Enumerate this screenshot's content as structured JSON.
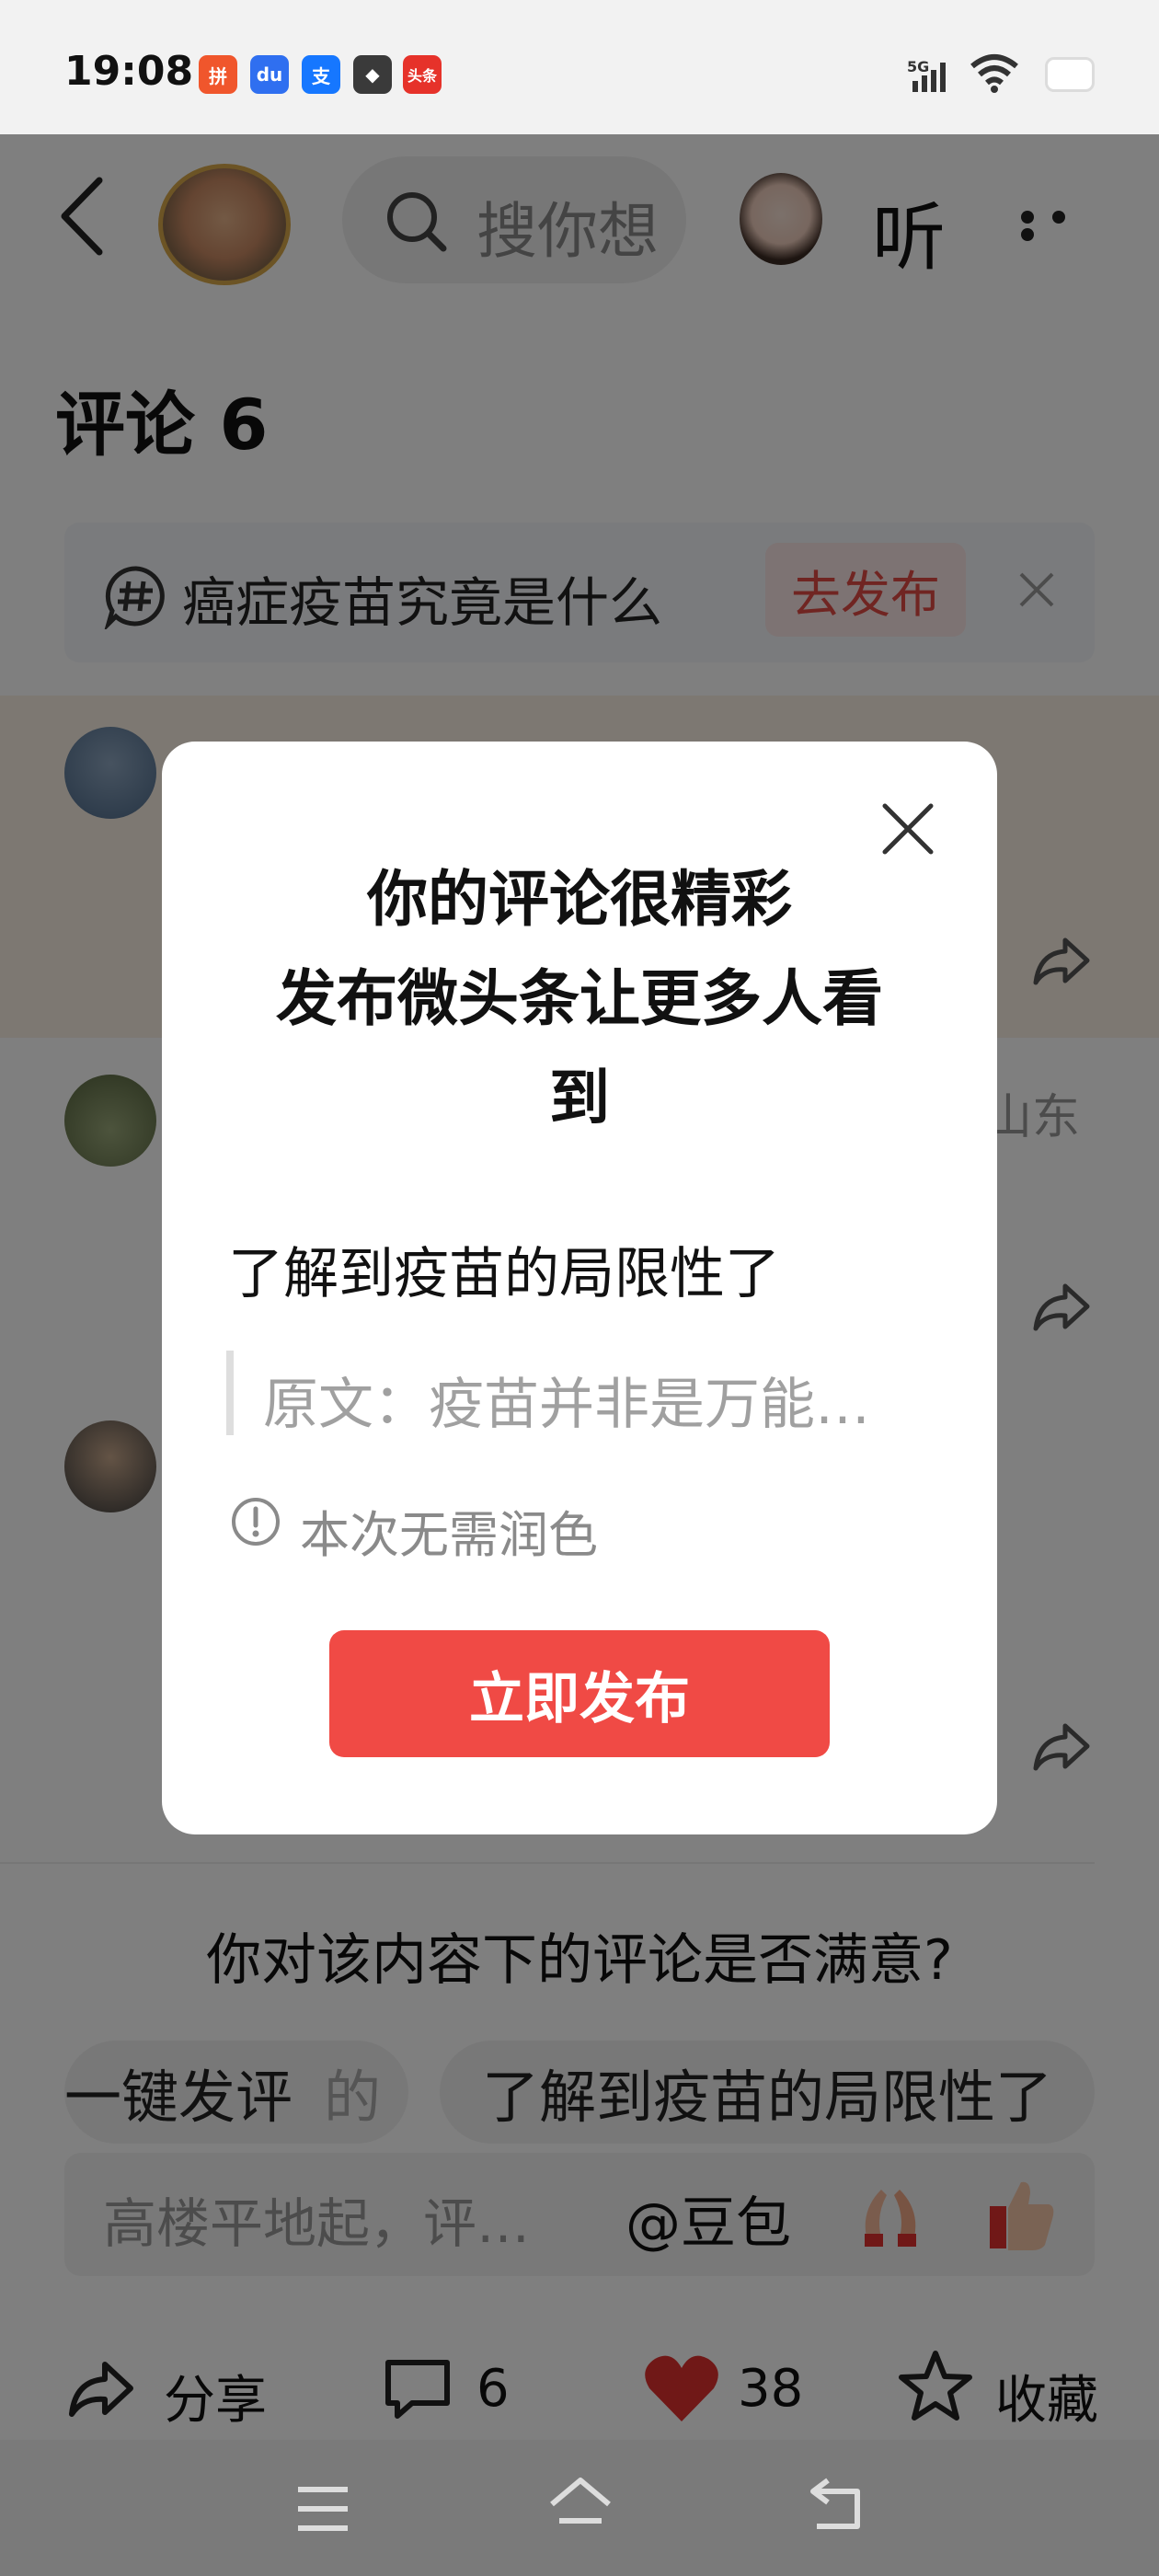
{
  "status_bar": {
    "time": "19:08",
    "apps": [
      "拼多多",
      "百度",
      "支付宝",
      "游戏",
      "头条"
    ],
    "battery_icon": "battery-icon",
    "network_label": "5G"
  },
  "header": {
    "search_placeholder": "搜你想",
    "listen_label": "听"
  },
  "comments": {
    "title": "评论 6",
    "topic_text": "癌症疫苗究竟是什么",
    "publish_label": "去发布",
    "location": "山东"
  },
  "satisfaction": {
    "question": "你对该内容下的评论是否满意?"
  },
  "quick_comments": {
    "chip_partial": "一键发评",
    "chip_partial_tail": "的",
    "chip_main": "了解到疫苗的局限性了"
  },
  "composer": {
    "placeholder": "高楼平地起，评…",
    "mention": "@豆包"
  },
  "toolbar": {
    "share_label": "分享",
    "comment_count": "6",
    "like_count": "38",
    "favorite_label": "收藏"
  },
  "dialog": {
    "title_line1": "你的评论很精彩",
    "title_line2": "发布微头条让更多人看",
    "title_line3": "到",
    "comment_text": "了解到疫苗的局限性了",
    "quote_text": "原文：疫苗并非是万能…",
    "info_text": "本次无需润色",
    "button_label": "立即发布"
  },
  "colors": {
    "accent": "#f04a45",
    "like_red": "#e0302e",
    "overlay": "rgba(0,0,0,0.5)"
  }
}
